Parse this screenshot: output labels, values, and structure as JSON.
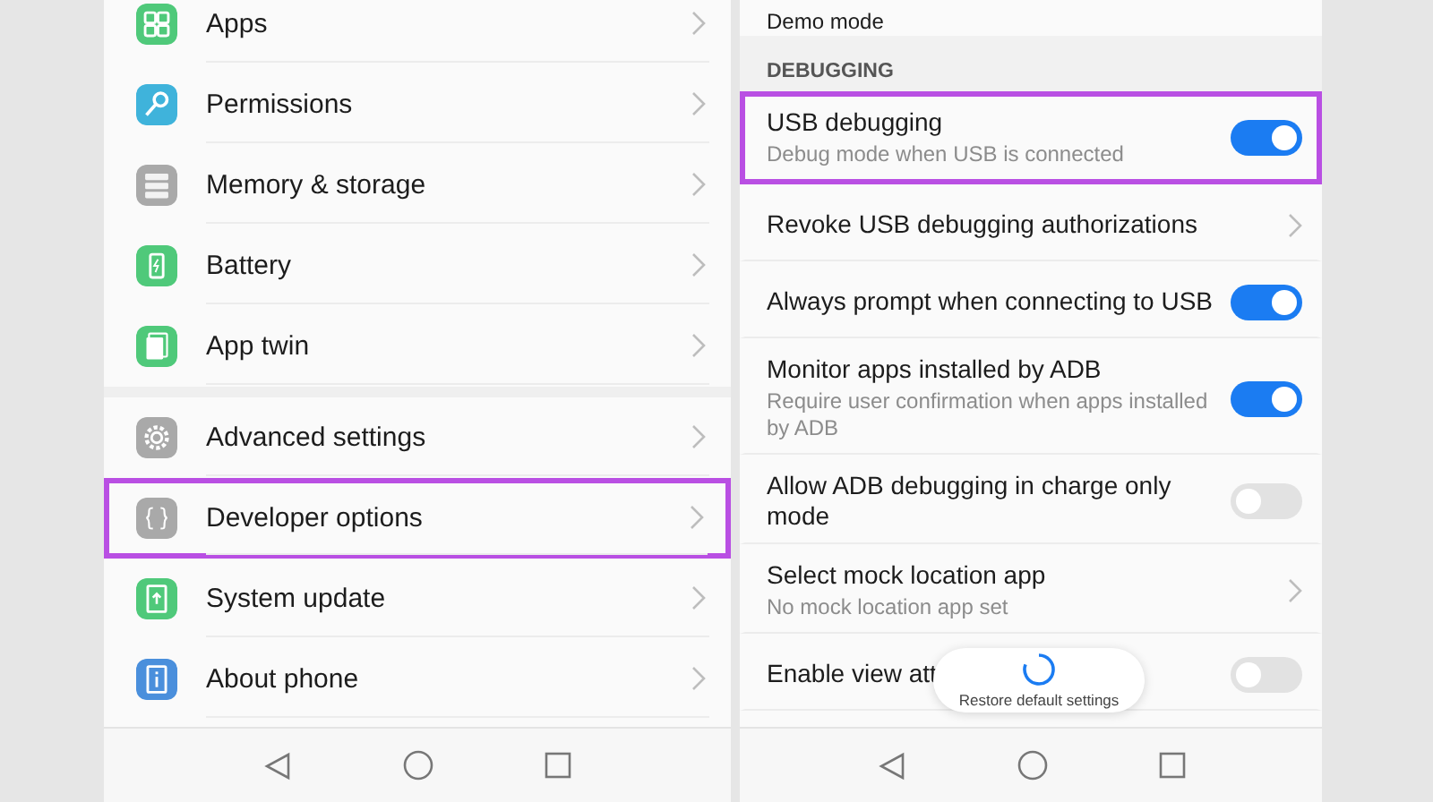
{
  "left": {
    "groups": [
      {
        "items": [
          {
            "label": "Apps",
            "color": "#4fc97a",
            "highlighted": false
          },
          {
            "label": "Permissions",
            "color": "#3fb3db",
            "highlighted": false
          },
          {
            "label": "Memory & storage",
            "color": "#a9a9a9",
            "highlighted": false
          },
          {
            "label": "Battery",
            "color": "#4fc97a",
            "highlighted": false
          },
          {
            "label": "App twin",
            "color": "#4fc97a",
            "highlighted": false
          }
        ]
      },
      {
        "items": [
          {
            "label": "Advanced settings",
            "color": "#a9a9a9",
            "highlighted": false
          },
          {
            "label": "Developer options",
            "color": "#a9a9a9",
            "highlighted": true
          },
          {
            "label": "System update",
            "color": "#4fc97a",
            "highlighted": false
          },
          {
            "label": "About phone",
            "color": "#4a8fdc",
            "highlighted": false
          }
        ]
      }
    ]
  },
  "right": {
    "top_item": {
      "label": "Demo mode"
    },
    "section": "DEBUGGING",
    "items": [
      {
        "kind": "toggle",
        "title": "USB debugging",
        "subtitle": "Debug mode when USB is connected",
        "on": true,
        "highlighted": true
      },
      {
        "kind": "link",
        "title": "Revoke USB debugging authorizations",
        "highlighted": false
      },
      {
        "kind": "toggle",
        "title": "Always prompt when connecting to USB",
        "on": true,
        "highlighted": false
      },
      {
        "kind": "toggle",
        "title": "Monitor apps installed by ADB",
        "subtitle": "Require user confirmation when apps installed by ADB",
        "on": true,
        "highlighted": false
      },
      {
        "kind": "toggle",
        "title": "Allow ADB debugging in charge only mode",
        "on": false,
        "highlighted": false
      },
      {
        "kind": "link",
        "title": "Select mock location app",
        "subtitle": "No mock location app set",
        "highlighted": false
      },
      {
        "kind": "toggle",
        "title": "Enable view att",
        "on": false,
        "highlighted": false
      }
    ],
    "toast": "Restore default settings"
  }
}
